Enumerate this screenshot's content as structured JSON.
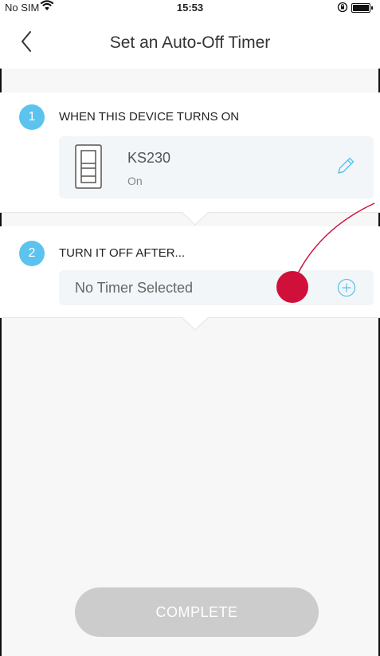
{
  "status_bar": {
    "carrier": "No SIM",
    "time": "15:53",
    "wifi_icon": "wifi-icon",
    "lock_icon": "orientation-lock-icon",
    "battery_icon": "battery-icon"
  },
  "nav": {
    "title": "Set an Auto-Off Timer",
    "back_icon": "chevron-left-icon"
  },
  "step1": {
    "number": "1",
    "label": "WHEN THIS DEVICE TURNS ON",
    "device": {
      "name": "KS230",
      "state": "On",
      "icon": "light-switch-icon",
      "edit_icon": "pencil-icon"
    }
  },
  "step2": {
    "number": "2",
    "label": "TURN IT OFF AFTER...",
    "timer_placeholder": "No Timer Selected",
    "add_icon": "plus-circle-icon"
  },
  "complete_button": {
    "label": "COMPLETE"
  },
  "colors": {
    "accent": "#5cc3ef",
    "touch_indicator": "#d0103a",
    "disabled_button": "#cccccc"
  }
}
